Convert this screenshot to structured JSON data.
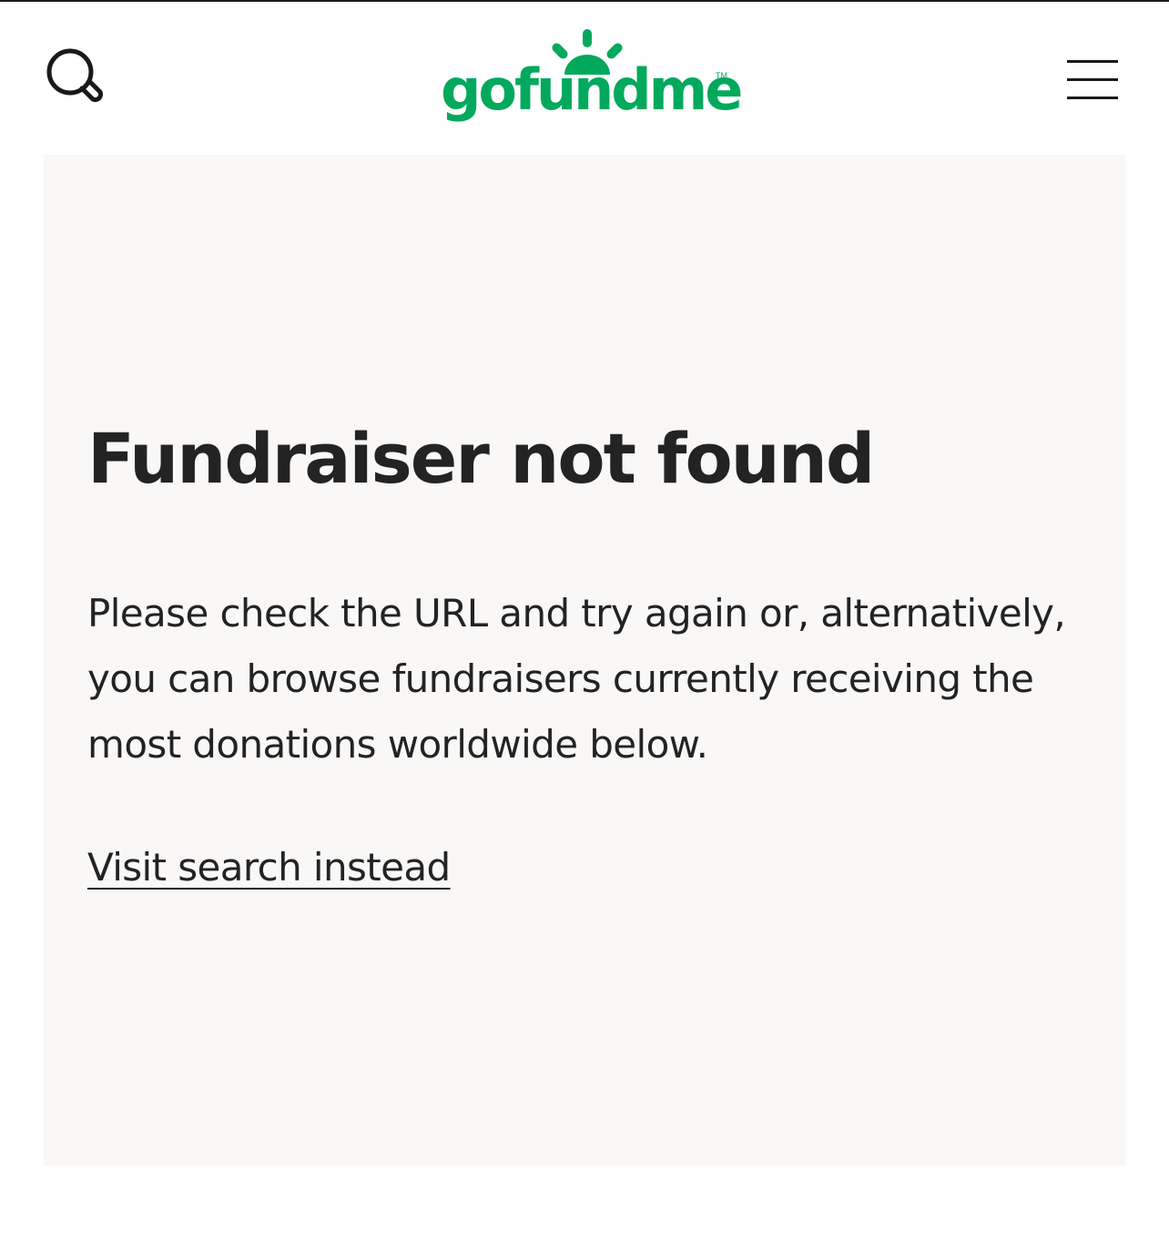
{
  "header": {
    "logo_text": "gofundme",
    "logo_tm": "TM",
    "brand_color": "#02a95c",
    "search_icon": "search-icon",
    "menu_icon": "hamburger-menu-icon"
  },
  "main": {
    "title": "Fundraiser not found",
    "message": "Please check the URL and try again or, alternatively, you can browse fundraisers currently receiving the most donations worldwide below.",
    "search_link_label": "Visit search instead",
    "card_background": "#f9f8f7",
    "text_color": "#232323"
  }
}
